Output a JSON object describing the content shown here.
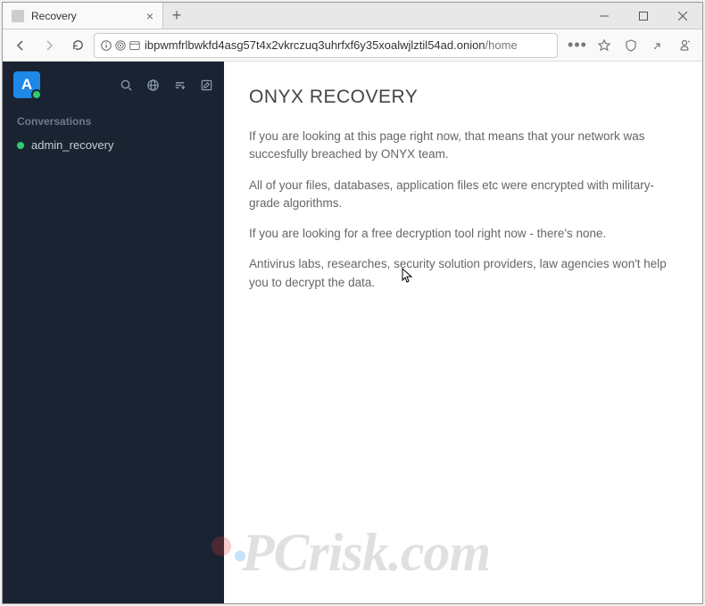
{
  "window": {
    "tab_title": "Recovery"
  },
  "url": {
    "host": "ibpwmfrlbwkfd4asg57t4x2vkrczuq3uhrfxf6y35xoalwjlztil54ad.onion",
    "path": "/home"
  },
  "sidebar": {
    "app_initial": "A",
    "section_label": "Conversations",
    "items": [
      {
        "label": "admin_recovery"
      }
    ]
  },
  "main": {
    "heading": "ONYX RECOVERY",
    "paragraphs": [
      "If you are looking at this page right now, that means that your network was succesfully breached by ONYX team.",
      "All of your files, databases, application files etc were encrypted with military-grade algorithms.",
      "If you are looking for a free decryption tool right now - there's none.",
      "Antivirus labs, researches, security solution providers, law agencies won't help you to decrypt the data."
    ]
  },
  "watermark": {
    "text": "PCrisk.com"
  }
}
